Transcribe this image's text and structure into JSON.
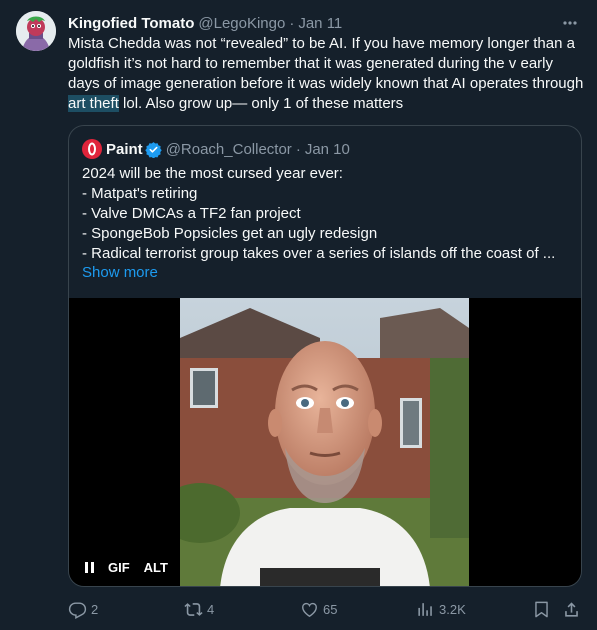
{
  "tweet": {
    "display_name": "Kingofied Tomato",
    "handle": "@LegoKingo",
    "separator": "·",
    "date": "Jan 11",
    "more_label": "···",
    "text_before": "Mista Chedda was not “revealed” to be AI. If you have memory longer than a goldfish it’s not hard to remember that it was generated during the v early days of image generation before it was widely known that AI operates through ",
    "text_highlight": "art theft",
    "text_after": " lol. Also grow up— only 1 of these matters"
  },
  "quote": {
    "display_name": "Paint",
    "handle": "@Roach_Collector",
    "separator": "·",
    "date": "Jan 10",
    "lines": [
      "2024 will be the most cursed year ever:",
      "- Matpat's retiring",
      "- Valve DMCAs a TF2 fan project",
      "- SpongeBob Popsicles get an ugly redesign",
      "- Radical terrorist group takes over a series of islands off the coast of ..."
    ],
    "show_more": "Show more",
    "media": {
      "gif_label": "GIF",
      "alt_label": "ALT"
    }
  },
  "actions": {
    "replies": "2",
    "reposts": "4",
    "likes": "65",
    "views": "3.2K"
  },
  "colors": {
    "background": "#15202b",
    "text": "#f7f9f9",
    "secondary": "#8b98a5",
    "accent": "#1d9bf0",
    "border": "#38444d"
  }
}
